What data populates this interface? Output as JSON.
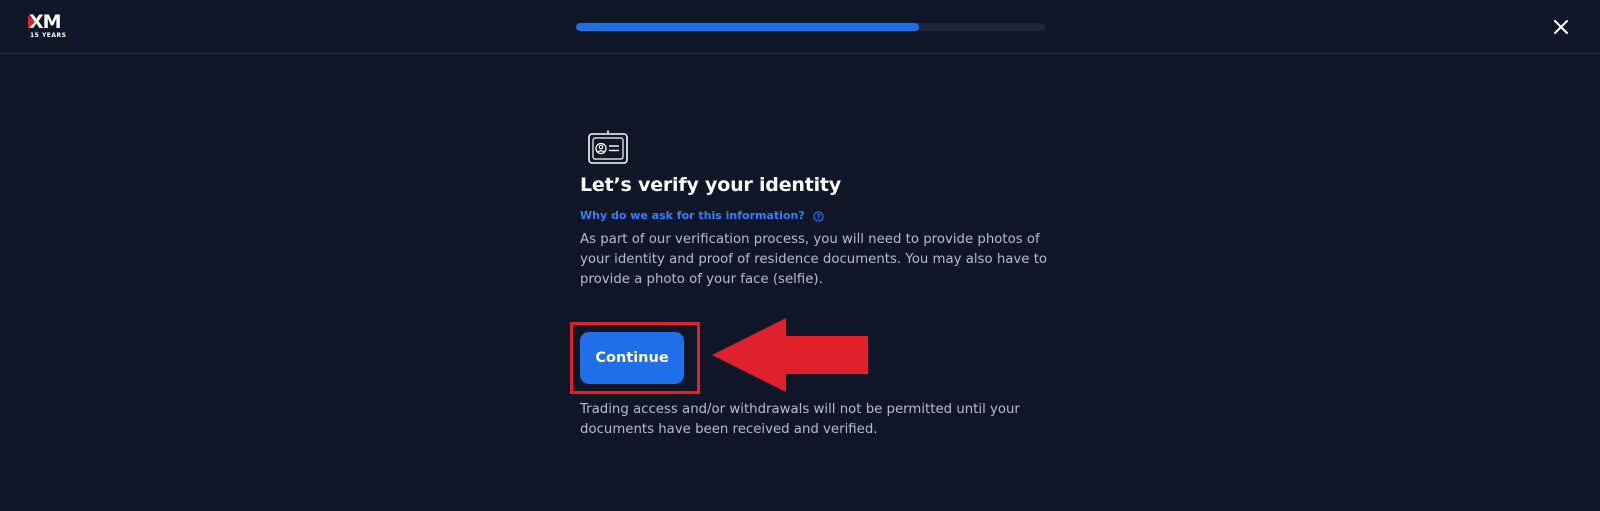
{
  "header": {
    "logo_text": "XM",
    "logo_subtext": "15 YEARS",
    "progress_value": 0.73,
    "close_icon": "close-icon"
  },
  "main": {
    "icon": "id-card-icon",
    "title": "Let’s verify your identity",
    "why_link": "Why do we ask for this information?",
    "help_icon": "question-circle-icon",
    "description": "As part of our verification process, you will need to provide photos of your identity and proof of residence documents. You may also have to provide a photo of your face (selfie).",
    "continue_label": "Continue",
    "notice": "Trading access and/or withdrawals will not be permitted until your documents have been received and verified."
  },
  "annotation": {
    "highlight_color": "#e0212b",
    "arrow_color": "#e0212b"
  },
  "colors": {
    "background": "#0e1628",
    "accent": "#1f6fe8",
    "link": "#2f80ff",
    "text": "#ffffff",
    "muted_text": "#b3bccb"
  }
}
